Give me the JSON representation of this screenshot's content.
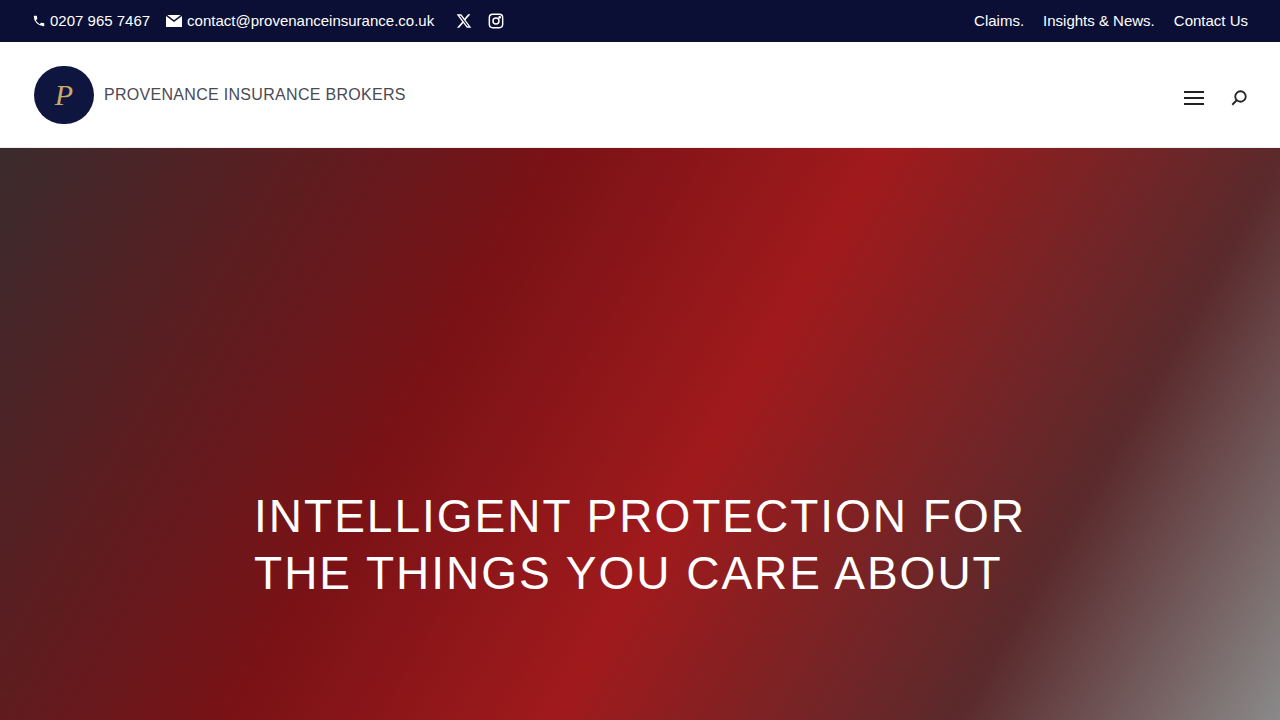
{
  "topbar": {
    "phone": "0207 965 7467",
    "email": "contact@provenanceinsurance.co.uk",
    "links": [
      "Claims.",
      "Insights & News.",
      "Contact Us"
    ]
  },
  "header": {
    "logo_mark": "P",
    "brand": "PROVENANCE INSURANCE BROKERS"
  },
  "hero": {
    "headline_lines": [
      "INTELLIGENT PROTECTION FOR",
      "THE THINGS YOU CARE ABOUT"
    ]
  }
}
